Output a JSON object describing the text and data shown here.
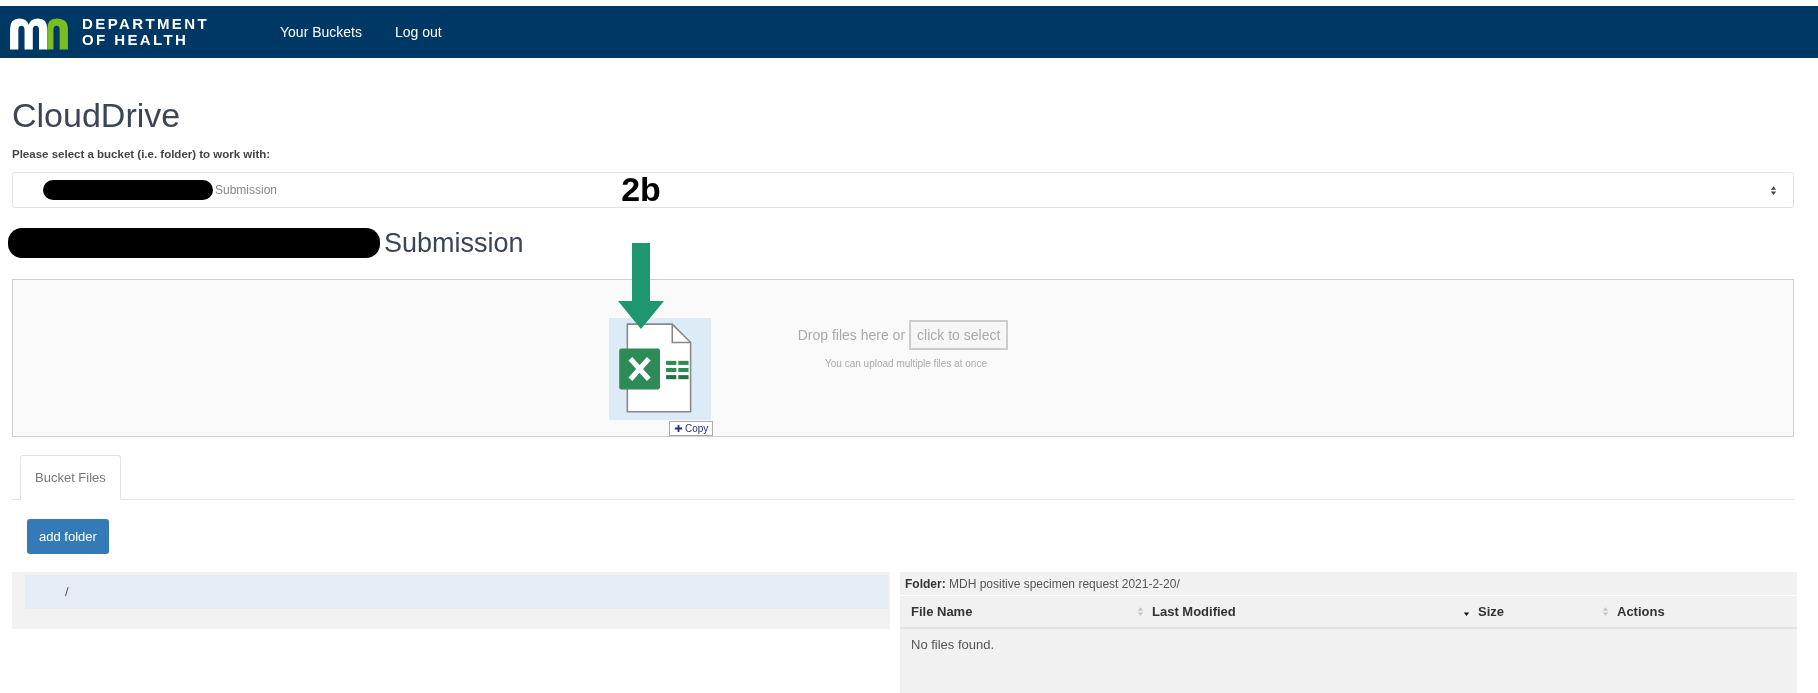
{
  "header": {
    "logo_lines": [
      "DEPARTMENT",
      "OF HEALTH"
    ],
    "nav": [
      {
        "label": "Your Buckets"
      },
      {
        "label": "Log out"
      }
    ]
  },
  "title": "CloudDrive",
  "bucket_select": {
    "label": "Please select a bucket (i.e. folder) to work with:",
    "value": "Submission"
  },
  "bucket_heading": "Submission",
  "annotation": {
    "label": "2b"
  },
  "dropzone": {
    "text": "Drop files here or",
    "button": "click to select",
    "hint": "You can upload multiple files at once",
    "drag_badge": "Copy"
  },
  "tabs": [
    {
      "label": "Bucket Files",
      "selected": true
    }
  ],
  "add_folder": "add folder",
  "tree": [
    {
      "label": "/",
      "selected": true
    }
  ],
  "folder": {
    "label": "Folder:",
    "path": "MDH positive specimen request 2021-2-20/"
  },
  "table": {
    "columns": [
      {
        "label": "File Name",
        "sortable": false
      },
      {
        "label": "Last Modified",
        "sortable": true,
        "sorted": false
      },
      {
        "label": "Size",
        "sortable": true,
        "sorted": true
      },
      {
        "label": "Actions",
        "sortable": true,
        "sorted": false
      }
    ],
    "empty": "No files found."
  }
}
